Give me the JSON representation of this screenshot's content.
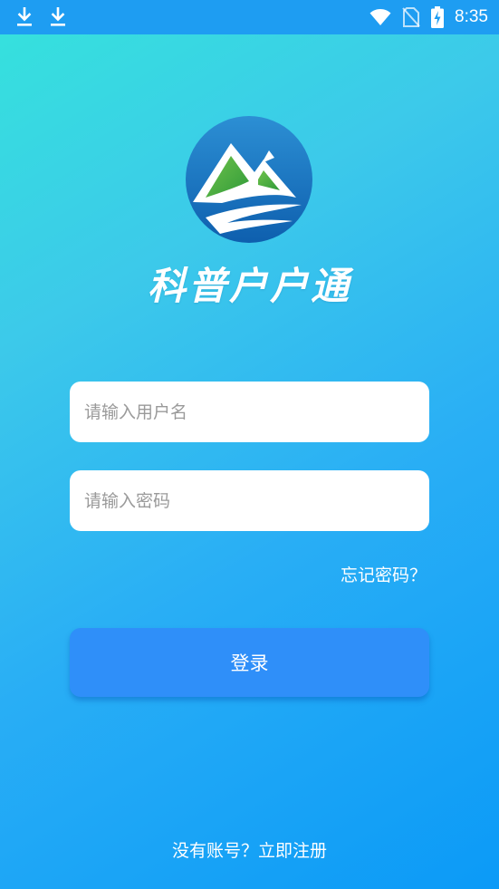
{
  "status_bar": {
    "time": "8:35",
    "icons": [
      "download-icon",
      "download-icon",
      "wifi-icon",
      "no-sim-icon",
      "battery-charging-icon"
    ]
  },
  "brand": {
    "logo_icon": "mountain-logo-icon",
    "title": "科普户户通"
  },
  "login_form": {
    "username_placeholder": "请输入用户名",
    "username_value": "",
    "password_placeholder": "请输入密码",
    "password_value": "",
    "forgot_label": "忘记密码？",
    "login_label": "登录"
  },
  "footer": {
    "register_label": "没有账号？立即注册"
  },
  "colors": {
    "status_bar": "#1e9df2",
    "button": "#2f8ff9",
    "gradient_start": "#35e3dc",
    "gradient_end": "#0b9af7"
  }
}
